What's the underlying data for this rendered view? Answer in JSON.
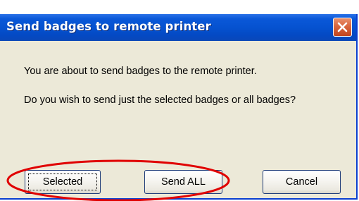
{
  "dialog": {
    "title": "Send badges to remote printer",
    "message_line1": "You are about to send badges to the remote printer.",
    "message_line2": "Do you wish to send just the selected badges or all badges?"
  },
  "buttons": {
    "selected_label": "Selected",
    "send_all_label": "Send ALL",
    "cancel_label": "Cancel"
  },
  "annotation": {
    "ellipse_color": "#e00000",
    "target": "Selected and Send ALL buttons"
  },
  "icons": {
    "close": "close-icon"
  }
}
